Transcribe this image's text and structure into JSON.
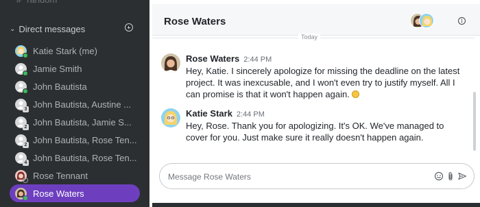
{
  "sidebar": {
    "previous_channel": "random",
    "dm_header": "Direct messages",
    "items": [
      {
        "label": "Katie Stark (me)",
        "avatar": "avatar-katie",
        "badge": "online"
      },
      {
        "label": "Jamie Smith",
        "avatar": "avatar-generic",
        "badge": "online"
      },
      {
        "label": "John Bautista",
        "avatar": "avatar-generic",
        "badge": "online"
      },
      {
        "label": "John Bautista, Austine ...",
        "avatar": "avatar-generic",
        "badge": "3"
      },
      {
        "label": "John Bautista, Jamie S...",
        "avatar": "avatar-generic",
        "badge": "2"
      },
      {
        "label": "John Bautista, Rose Ten...",
        "avatar": "avatar-generic",
        "badge": "2"
      },
      {
        "label": "John Bautista, Rose Ten...",
        "avatar": "avatar-generic",
        "badge": "4"
      },
      {
        "label": "Rose Tennant",
        "avatar": "avatar-rose-t",
        "badge": "offline"
      },
      {
        "label": "Rose Waters",
        "avatar": "avatar-rose-w",
        "badge": "online",
        "active": true
      }
    ]
  },
  "channel": {
    "title": "Rose Waters",
    "day_separator": "Today"
  },
  "messages": [
    {
      "author": "Rose Waters",
      "time": "2:44 PM",
      "text": "Hey, Katie. I sincerely apologize for missing the deadline on the latest project. It was inexcusable, and I won't even try to justify myself. All I can promise is that it won't happen again.",
      "emoji": "slightly-smiling-face"
    },
    {
      "author": "Katie Stark",
      "time": "2:44 PM",
      "text": "Hey, Rose. Thank you for apologizing. It's OK. We've managed to cover for you. Just make sure it really doesn't happen again."
    }
  ],
  "composer": {
    "placeholder": "Message Rose Waters"
  },
  "colors": {
    "sidebar_bg": "#2c2f31",
    "active_item": "#6d3fbf",
    "online": "#3dbb5a"
  }
}
